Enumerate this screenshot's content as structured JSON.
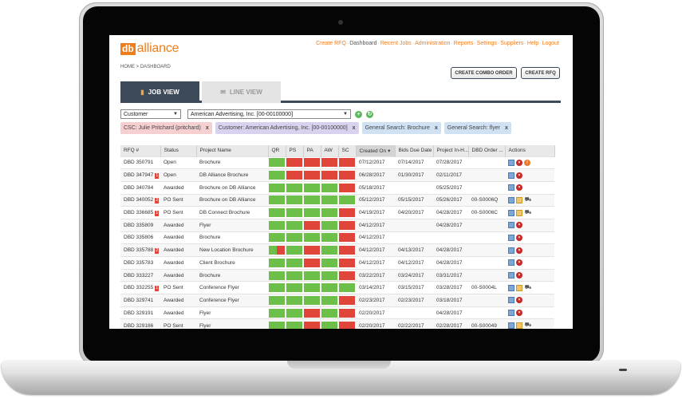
{
  "app": {
    "logo_mark": "db",
    "logo_text": "alliance"
  },
  "nav": {
    "items": [
      {
        "label": "Create RFQ",
        "active": false
      },
      {
        "label": "Dashboard",
        "active": true
      },
      {
        "label": "Recent Jobs",
        "active": false
      },
      {
        "label": "Administration",
        "active": false
      },
      {
        "label": "Reports",
        "active": false
      },
      {
        "label": "Settings",
        "active": false
      },
      {
        "label": "Suppliers",
        "active": false
      },
      {
        "label": "Help",
        "active": false
      },
      {
        "label": "Logout",
        "active": false
      }
    ],
    "separator": "·"
  },
  "breadcrumb": "HOME  >  DASHBOARD",
  "buttons": {
    "create_combo": "CREATE COMBO ORDER",
    "create_rfq": "CREATE RFQ"
  },
  "tabs": {
    "job_view": "JOB VIEW",
    "line_view": "LINE VIEW"
  },
  "filters": {
    "type_select": "Customer",
    "customer_select": "American Advertising, Inc. [00-00100000]",
    "add_icon": "plus-circle-icon",
    "refresh_icon": "refresh-icon"
  },
  "chips": [
    {
      "label": "CSC: Julie Pritchard (pritchard)",
      "color": "#f6cfd0"
    },
    {
      "label": "Customer: American Advertising, Inc. [00-00100000]",
      "color": "#d9d2ef"
    },
    {
      "label": "General Search: Brochure",
      "color": "#cfe1f3"
    },
    {
      "label": "General Search: flyer",
      "color": "#cfe1f3"
    }
  ],
  "chip_remove": "x",
  "table": {
    "headers": [
      "RFQ #",
      "Status",
      "Project Name",
      "QR",
      "PS",
      "PA",
      "AW",
      "SC",
      "Created On",
      "Bids Due Date",
      "Project In-H...",
      "DBD Order ...",
      "Actions"
    ],
    "sorted_indicator": "▾",
    "rows": [
      {
        "rfq": "DBD 350791",
        "badge": "",
        "status": "Open",
        "project": "Brochure",
        "stages": [
          "g",
          "r",
          "r",
          "r",
          "r"
        ],
        "created": "07/12/2017",
        "bids_due": "07/14/2017",
        "in_hand": "07/28/2017",
        "order": "",
        "actions": [
          "copy",
          "del",
          "warn"
        ]
      },
      {
        "rfq": "DBD 347947",
        "badge": "1",
        "status": "Open",
        "project": "DB Alliance Brochure",
        "stages": [
          "g",
          "r",
          "r",
          "r",
          "r"
        ],
        "created": "06/28/2017",
        "bids_due": "01/30/2017",
        "in_hand": "02/11/2017",
        "order": "",
        "actions": [
          "copy",
          "del"
        ]
      },
      {
        "rfq": "DBD 340784",
        "badge": "",
        "status": "Awarded",
        "project": "Brochure on DB Alliance",
        "stages": [
          "g",
          "g",
          "g",
          "g",
          "r"
        ],
        "created": "05/18/2017",
        "bids_due": "",
        "in_hand": "05/25/2017",
        "order": "",
        "actions": [
          "copy",
          "del"
        ]
      },
      {
        "rfq": "DBD 340052",
        "badge": "2",
        "status": "PO Sent",
        "project": "Brochure on DB Alliance",
        "stages": [
          "g",
          "g",
          "g",
          "g",
          "g"
        ],
        "created": "05/12/2017",
        "bids_due": "05/15/2017",
        "in_hand": "05/26/2017",
        "order": "00-S0006Q",
        "actions": [
          "copy",
          "doc",
          "truck"
        ]
      },
      {
        "rfq": "DBD 336685",
        "badge": "1",
        "status": "PO Sent",
        "project": "DB Connect Brochure",
        "stages": [
          "g",
          "g",
          "g",
          "g",
          "r"
        ],
        "created": "04/19/2017",
        "bids_due": "04/20/2017",
        "in_hand": "04/28/2017",
        "order": "00-S0006C",
        "actions": [
          "copy",
          "doc",
          "truck"
        ]
      },
      {
        "rfq": "DBD 335809",
        "badge": "",
        "status": "Awarded",
        "project": "Flyer",
        "stages": [
          "g",
          "g",
          "r",
          "g",
          "r"
        ],
        "created": "04/12/2017",
        "bids_due": "",
        "in_hand": "04/28/2017",
        "order": "",
        "actions": [
          "copy",
          "del"
        ]
      },
      {
        "rfq": "DBD 335806",
        "badge": "",
        "status": "Awarded",
        "project": "Brochure",
        "stages": [
          "g",
          "g",
          "g",
          "g",
          "r"
        ],
        "created": "04/12/2017",
        "bids_due": "",
        "in_hand": "",
        "order": "",
        "actions": [
          "copy",
          "del"
        ]
      },
      {
        "rfq": "DBD 335788",
        "badge": "2",
        "status": "Awarded",
        "project": "New Location Brochure",
        "stages": [
          "gr",
          "g",
          "r",
          "g",
          "r"
        ],
        "created": "04/12/2017",
        "bids_due": "04/13/2017",
        "in_hand": "04/28/2017",
        "order": "",
        "actions": [
          "copy",
          "del"
        ]
      },
      {
        "rfq": "DBD 335783",
        "badge": "",
        "status": "Awarded",
        "project": "Client Brochure",
        "stages": [
          "g",
          "g",
          "r",
          "g",
          "r"
        ],
        "created": "04/12/2017",
        "bids_due": "04/12/2017",
        "in_hand": "04/28/2017",
        "order": "",
        "actions": [
          "copy",
          "del"
        ]
      },
      {
        "rfq": "DBD 333227",
        "badge": "",
        "status": "Awarded",
        "project": "Brochure",
        "stages": [
          "g",
          "g",
          "g",
          "g",
          "r"
        ],
        "created": "03/22/2017",
        "bids_due": "03/24/2017",
        "in_hand": "03/31/2017",
        "order": "",
        "actions": [
          "copy",
          "del"
        ]
      },
      {
        "rfq": "DBD 332255",
        "badge": "1",
        "status": "PO Sent",
        "project": "Conference Flyer",
        "stages": [
          "g",
          "g",
          "g",
          "g",
          "g"
        ],
        "created": "03/14/2017",
        "bids_due": "03/15/2017",
        "in_hand": "03/28/2017",
        "order": "00-S0004L",
        "actions": [
          "copy",
          "doc",
          "truck"
        ]
      },
      {
        "rfq": "DBD 329741",
        "badge": "",
        "status": "Awarded",
        "project": "Conference Flyer",
        "stages": [
          "g",
          "g",
          "g",
          "g",
          "r"
        ],
        "created": "02/23/2017",
        "bids_due": "02/23/2017",
        "in_hand": "03/18/2017",
        "order": "",
        "actions": [
          "copy",
          "del"
        ]
      },
      {
        "rfq": "DBD 329191",
        "badge": "",
        "status": "Awarded",
        "project": "Flyer",
        "stages": [
          "g",
          "g",
          "r",
          "g",
          "r"
        ],
        "created": "02/20/2017",
        "bids_due": "",
        "in_hand": "04/28/2017",
        "order": "",
        "actions": [
          "copy",
          "del"
        ]
      },
      {
        "rfq": "DBD 329186",
        "badge": "",
        "status": "PO Sent",
        "project": "Flyer",
        "stages": [
          "g",
          "g",
          "r",
          "g",
          "r"
        ],
        "created": "02/20/2017",
        "bids_due": "02/22/2017",
        "in_hand": "02/28/2017",
        "order": "00-S00049",
        "actions": [
          "copy",
          "doc",
          "truck"
        ]
      }
    ]
  }
}
